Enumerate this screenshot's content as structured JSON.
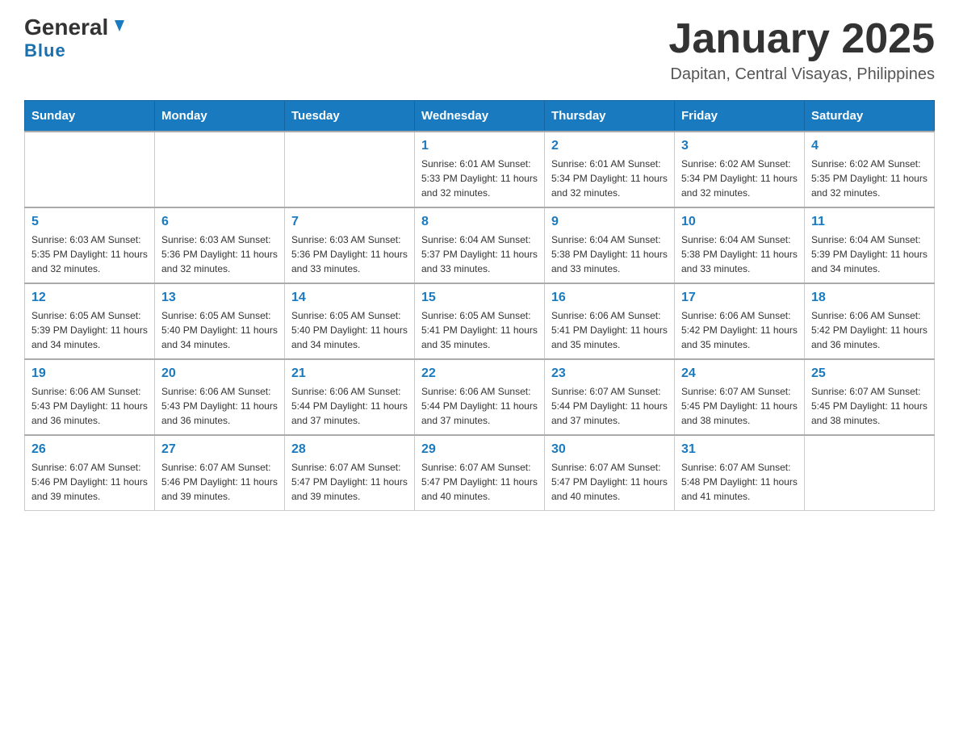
{
  "header": {
    "logo_main": "General",
    "logo_sub": "Blue",
    "month_title": "January 2025",
    "location": "Dapitan, Central Visayas, Philippines"
  },
  "days_of_week": [
    "Sunday",
    "Monday",
    "Tuesday",
    "Wednesday",
    "Thursday",
    "Friday",
    "Saturday"
  ],
  "weeks": [
    [
      {
        "day": "",
        "info": ""
      },
      {
        "day": "",
        "info": ""
      },
      {
        "day": "",
        "info": ""
      },
      {
        "day": "1",
        "info": "Sunrise: 6:01 AM\nSunset: 5:33 PM\nDaylight: 11 hours\nand 32 minutes."
      },
      {
        "day": "2",
        "info": "Sunrise: 6:01 AM\nSunset: 5:34 PM\nDaylight: 11 hours\nand 32 minutes."
      },
      {
        "day": "3",
        "info": "Sunrise: 6:02 AM\nSunset: 5:34 PM\nDaylight: 11 hours\nand 32 minutes."
      },
      {
        "day": "4",
        "info": "Sunrise: 6:02 AM\nSunset: 5:35 PM\nDaylight: 11 hours\nand 32 minutes."
      }
    ],
    [
      {
        "day": "5",
        "info": "Sunrise: 6:03 AM\nSunset: 5:35 PM\nDaylight: 11 hours\nand 32 minutes."
      },
      {
        "day": "6",
        "info": "Sunrise: 6:03 AM\nSunset: 5:36 PM\nDaylight: 11 hours\nand 32 minutes."
      },
      {
        "day": "7",
        "info": "Sunrise: 6:03 AM\nSunset: 5:36 PM\nDaylight: 11 hours\nand 33 minutes."
      },
      {
        "day": "8",
        "info": "Sunrise: 6:04 AM\nSunset: 5:37 PM\nDaylight: 11 hours\nand 33 minutes."
      },
      {
        "day": "9",
        "info": "Sunrise: 6:04 AM\nSunset: 5:38 PM\nDaylight: 11 hours\nand 33 minutes."
      },
      {
        "day": "10",
        "info": "Sunrise: 6:04 AM\nSunset: 5:38 PM\nDaylight: 11 hours\nand 33 minutes."
      },
      {
        "day": "11",
        "info": "Sunrise: 6:04 AM\nSunset: 5:39 PM\nDaylight: 11 hours\nand 34 minutes."
      }
    ],
    [
      {
        "day": "12",
        "info": "Sunrise: 6:05 AM\nSunset: 5:39 PM\nDaylight: 11 hours\nand 34 minutes."
      },
      {
        "day": "13",
        "info": "Sunrise: 6:05 AM\nSunset: 5:40 PM\nDaylight: 11 hours\nand 34 minutes."
      },
      {
        "day": "14",
        "info": "Sunrise: 6:05 AM\nSunset: 5:40 PM\nDaylight: 11 hours\nand 34 minutes."
      },
      {
        "day": "15",
        "info": "Sunrise: 6:05 AM\nSunset: 5:41 PM\nDaylight: 11 hours\nand 35 minutes."
      },
      {
        "day": "16",
        "info": "Sunrise: 6:06 AM\nSunset: 5:41 PM\nDaylight: 11 hours\nand 35 minutes."
      },
      {
        "day": "17",
        "info": "Sunrise: 6:06 AM\nSunset: 5:42 PM\nDaylight: 11 hours\nand 35 minutes."
      },
      {
        "day": "18",
        "info": "Sunrise: 6:06 AM\nSunset: 5:42 PM\nDaylight: 11 hours\nand 36 minutes."
      }
    ],
    [
      {
        "day": "19",
        "info": "Sunrise: 6:06 AM\nSunset: 5:43 PM\nDaylight: 11 hours\nand 36 minutes."
      },
      {
        "day": "20",
        "info": "Sunrise: 6:06 AM\nSunset: 5:43 PM\nDaylight: 11 hours\nand 36 minutes."
      },
      {
        "day": "21",
        "info": "Sunrise: 6:06 AM\nSunset: 5:44 PM\nDaylight: 11 hours\nand 37 minutes."
      },
      {
        "day": "22",
        "info": "Sunrise: 6:06 AM\nSunset: 5:44 PM\nDaylight: 11 hours\nand 37 minutes."
      },
      {
        "day": "23",
        "info": "Sunrise: 6:07 AM\nSunset: 5:44 PM\nDaylight: 11 hours\nand 37 minutes."
      },
      {
        "day": "24",
        "info": "Sunrise: 6:07 AM\nSunset: 5:45 PM\nDaylight: 11 hours\nand 38 minutes."
      },
      {
        "day": "25",
        "info": "Sunrise: 6:07 AM\nSunset: 5:45 PM\nDaylight: 11 hours\nand 38 minutes."
      }
    ],
    [
      {
        "day": "26",
        "info": "Sunrise: 6:07 AM\nSunset: 5:46 PM\nDaylight: 11 hours\nand 39 minutes."
      },
      {
        "day": "27",
        "info": "Sunrise: 6:07 AM\nSunset: 5:46 PM\nDaylight: 11 hours\nand 39 minutes."
      },
      {
        "day": "28",
        "info": "Sunrise: 6:07 AM\nSunset: 5:47 PM\nDaylight: 11 hours\nand 39 minutes."
      },
      {
        "day": "29",
        "info": "Sunrise: 6:07 AM\nSunset: 5:47 PM\nDaylight: 11 hours\nand 40 minutes."
      },
      {
        "day": "30",
        "info": "Sunrise: 6:07 AM\nSunset: 5:47 PM\nDaylight: 11 hours\nand 40 minutes."
      },
      {
        "day": "31",
        "info": "Sunrise: 6:07 AM\nSunset: 5:48 PM\nDaylight: 11 hours\nand 41 minutes."
      },
      {
        "day": "",
        "info": ""
      }
    ]
  ]
}
